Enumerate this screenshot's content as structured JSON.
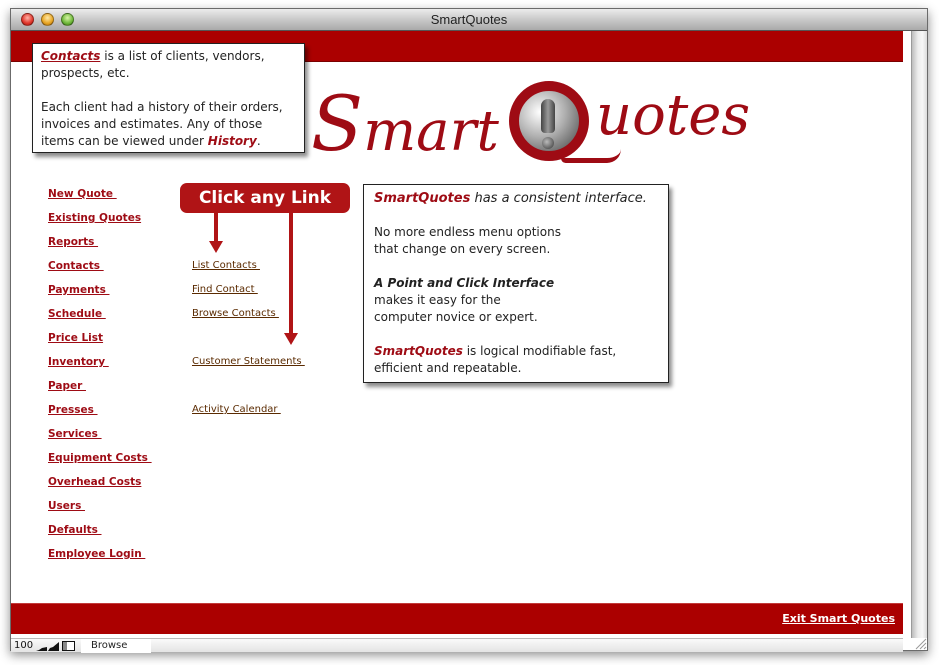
{
  "window": {
    "title": "SmartQuotes",
    "traffic_lights": [
      "close",
      "minimize",
      "zoom"
    ]
  },
  "brand": {
    "logo_text": "SmartQuotes",
    "logo_s": "S",
    "logo_mart": "mart",
    "logo_uotes": "uotes",
    "accent_color": "#ab0000",
    "logo_color": "#9e0b14"
  },
  "tooltip": {
    "link_label": "Contacts",
    "line1_rest": " is a list of clients, vendors, prospects, etc.",
    "line2_start": "Each client had a history of their orders, invoices and estimates. Any of those items can be viewed under ",
    "history_label": "History",
    "line2_end": "."
  },
  "nav": {
    "items": [
      {
        "label": "New Quote "
      },
      {
        "label": "Existing Quotes"
      },
      {
        "label": "Reports "
      },
      {
        "label": "Contacts "
      },
      {
        "label": "Payments "
      },
      {
        "label": "Schedule "
      },
      {
        "label": "Price List"
      },
      {
        "label": "Inventory "
      },
      {
        "label": "Paper "
      },
      {
        "label": "Presses "
      },
      {
        "label": "Services "
      },
      {
        "label": "Equipment Costs "
      },
      {
        "label": "Overhead Costs"
      },
      {
        "label": "Users "
      },
      {
        "label": "Defaults "
      },
      {
        "label": "Employee Login "
      }
    ]
  },
  "sublinks": {
    "items": [
      {
        "label": "List Contacts "
      },
      {
        "label": "Find Contact "
      },
      {
        "label": "Browse Contacts "
      },
      {
        "label": "Customer Statements "
      },
      {
        "label": "Activity Calendar "
      }
    ]
  },
  "callout": {
    "label": "Click any Link"
  },
  "infobox": {
    "brand": "SmartQuotes",
    "line1_rest": " has a consistent interface.",
    "para2_line1": "No more endless menu options",
    "para2_line2": "that change on every screen.",
    "para3_bold": "A Point and Click Interface",
    "para3_line2": "makes it easy for the",
    "para3_line3": "computer novice or expert.",
    "para4_rest": " is logical modifiable fast,",
    "para4_line2": "efficient and repeatable."
  },
  "footer": {
    "exit_label": "Exit Smart Quotes"
  },
  "statusbar": {
    "zoom_level": "100",
    "mode": "Browse"
  }
}
